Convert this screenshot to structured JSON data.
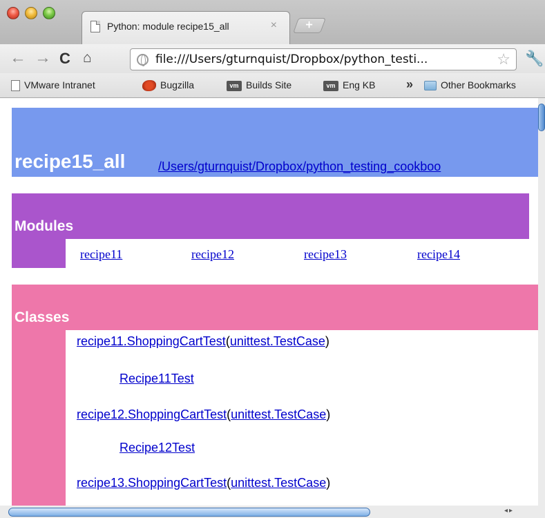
{
  "tab": {
    "title": "Python: module recipe15_all",
    "close_glyph": "×",
    "new_tab_glyph": "+"
  },
  "toolbar": {
    "back_glyph": "←",
    "forward_glyph": "→",
    "reload_glyph": "C",
    "home_glyph": "⌂",
    "url": "file:///Users/gturnquist/Dropbox/python_testi...",
    "star_glyph": "☆",
    "wrench_glyph": "🔧"
  },
  "bookmarks": {
    "items": [
      {
        "label": "VMware Intranet",
        "icon": "page-icon"
      },
      {
        "label": "Bugzilla",
        "icon": "bug-icon"
      },
      {
        "label": "Builds Site",
        "icon": "vm-icon",
        "badge": "vm"
      },
      {
        "label": "Eng KB",
        "icon": "vm-icon",
        "badge": "vm"
      }
    ],
    "overflow_glyph": "»",
    "other": "Other Bookmarks"
  },
  "page": {
    "module_name": "recipe15_all",
    "module_path": "/Users/gturnquist/Dropbox/python_testing_cookboo",
    "modules_title": "Modules",
    "modules": [
      "recipe11",
      "recipe12",
      "recipe13",
      "recipe14"
    ],
    "classes_title": "Classes",
    "classes": [
      {
        "base": "recipe11.ShoppingCartTest",
        "parent": "unittest.TestCase",
        "sub": "Recipe11Test"
      },
      {
        "base": "recipe12.ShoppingCartTest",
        "parent": "unittest.TestCase",
        "sub": "Recipe12Test"
      },
      {
        "base": "recipe13.ShoppingCartTest",
        "parent": "unittest.TestCase"
      }
    ]
  },
  "colors": {
    "heading_bar": "#7799ee",
    "modules_bar": "#aa55cc",
    "classes_bar": "#ee77aa",
    "link": "#0000cc"
  }
}
